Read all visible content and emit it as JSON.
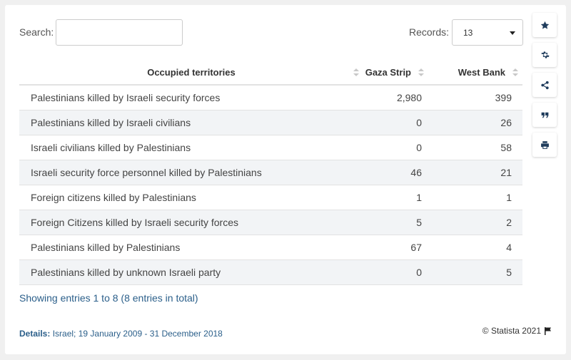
{
  "search": {
    "label": "Search:",
    "value": "",
    "placeholder": ""
  },
  "records": {
    "label": "Records:",
    "selected": "13"
  },
  "chart_data": {
    "type": "table",
    "columns": [
      "Occupied territories",
      "Gaza Strip",
      "West Bank"
    ],
    "rows": [
      [
        "Palestinians killed by Israeli security forces",
        "2,980",
        "399"
      ],
      [
        "Palestinians killed by Israeli civilians",
        "0",
        "26"
      ],
      [
        "Israeli civilians killed by Palestinians",
        "0",
        "58"
      ],
      [
        "Israeli security force personnel killed by Palestinians",
        "46",
        "21"
      ],
      [
        "Foreign citizens killed by Palestinians",
        "1",
        "1"
      ],
      [
        "Foreign Citizens killed by Israeli security forces",
        "5",
        "2"
      ],
      [
        "Palestinians killed by Palestinians",
        "67",
        "4"
      ],
      [
        "Palestinians killed by unknown Israeli party",
        "0",
        "5"
      ]
    ]
  },
  "footer": {
    "showing": "Showing entries 1 to 8 (8 entries in total)",
    "details_label": "Details:",
    "details_text": "Israel; 19 January 2009 - 31 December 2018",
    "copyright": "© Statista 2021"
  },
  "sidebar": {
    "icons": [
      "star-icon",
      "gear-icon",
      "share-icon",
      "quote-icon",
      "print-icon"
    ]
  }
}
